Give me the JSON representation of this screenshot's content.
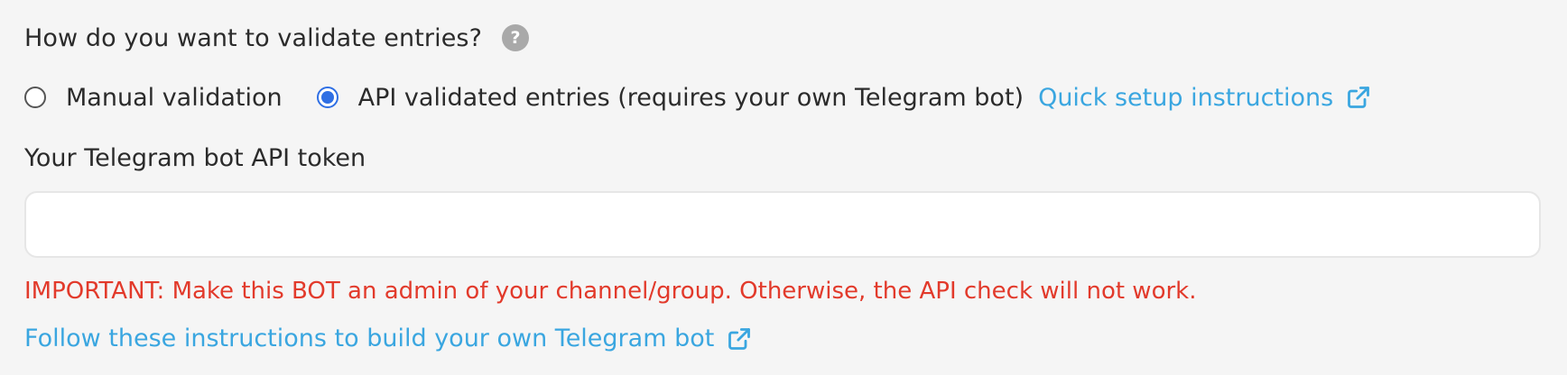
{
  "question": {
    "text": "How do you want to validate entries?",
    "help_icon": "question-mark-icon"
  },
  "validation_options": [
    {
      "label": "Manual validation",
      "selected": false
    },
    {
      "label": "API validated entries (requires your own Telegram bot)",
      "selected": true
    }
  ],
  "setup_link": {
    "label": "Quick setup instructions",
    "icon": "external-link-icon"
  },
  "token_field": {
    "label": "Your Telegram bot API token",
    "value": "",
    "placeholder": ""
  },
  "warning": {
    "text": "IMPORTANT: Make this BOT an admin of your channel/group. Otherwise, the API check will not work."
  },
  "instructions_link": {
    "label": "Follow these instructions to build your own Telegram bot",
    "icon": "external-link-icon"
  },
  "colors": {
    "background": "#f5f5f5",
    "text": "#2b2b2b",
    "link": "#3aa6e0",
    "warning": "#e23a2b",
    "radio_selected": "#2f6fe4",
    "help_icon_bg": "#a9a9a9"
  }
}
